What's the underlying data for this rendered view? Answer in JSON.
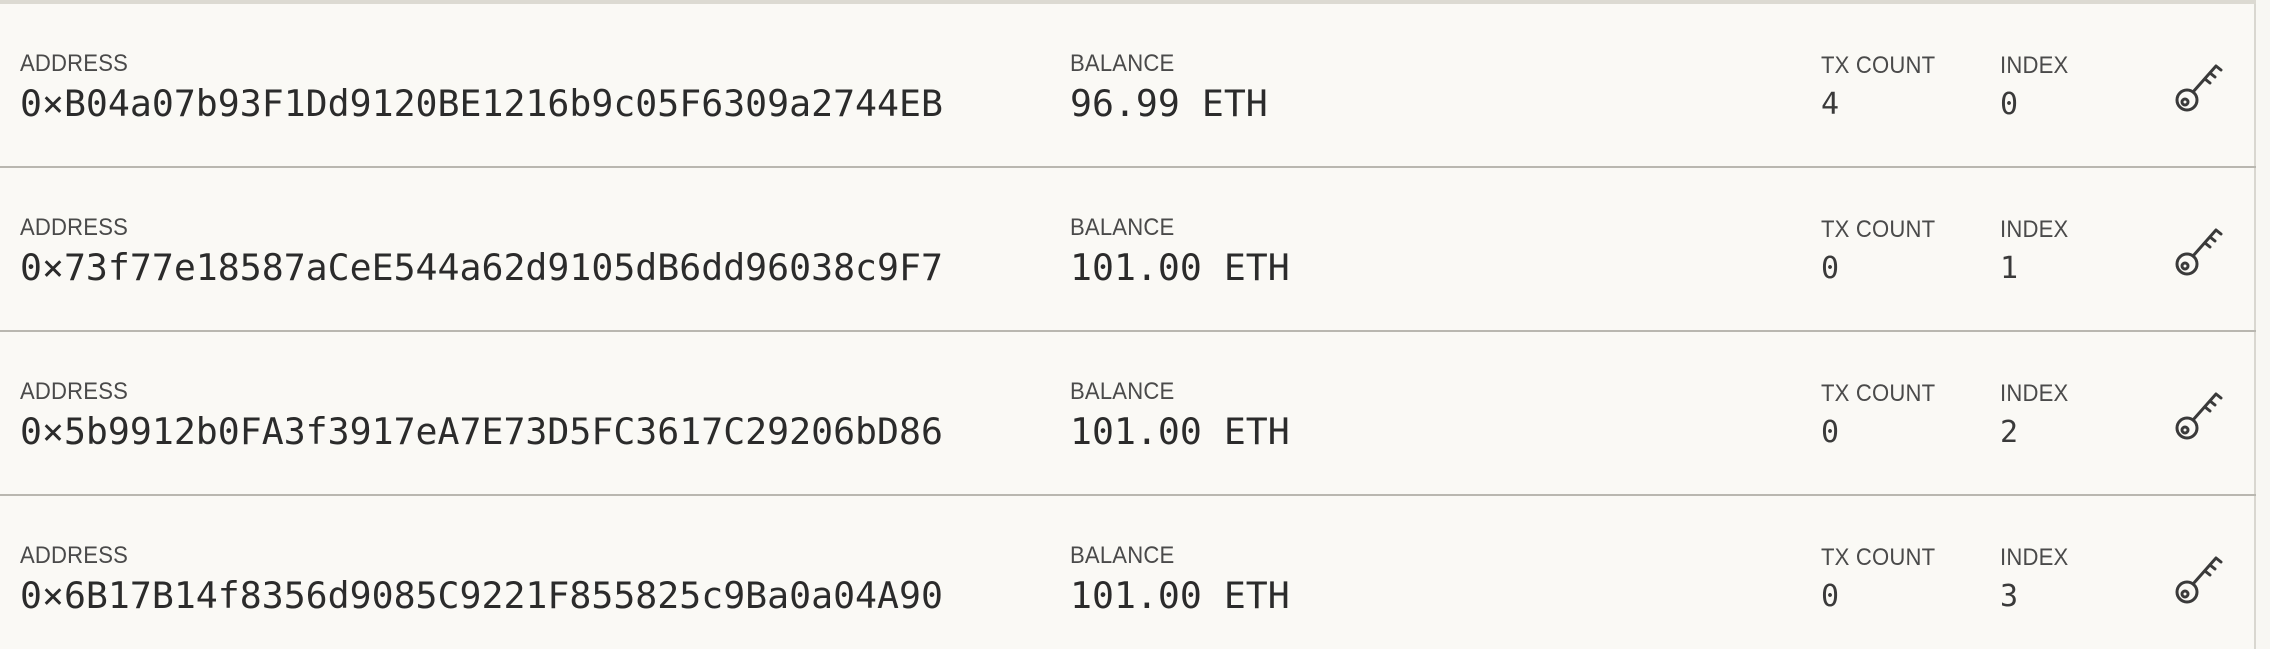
{
  "accounts": [
    {
      "address_label": "ADDRESS",
      "address": "0×B04a07b93F1Dd9120BE1216b9c05F6309a2744EB",
      "balance_label": "BALANCE",
      "balance": "96.99 ETH",
      "tx_count_label": "TX COUNT",
      "tx_count": "4",
      "index_label": "INDEX",
      "index": "0",
      "action_icon": "key-icon"
    },
    {
      "address_label": "ADDRESS",
      "address": "0×73f77e18587aCeE544a62d9105dB6dd96038c9F7",
      "balance_label": "BALANCE",
      "balance": "101.00 ETH",
      "tx_count_label": "TX COUNT",
      "tx_count": "0",
      "index_label": "INDEX",
      "index": "1",
      "action_icon": "key-icon"
    },
    {
      "address_label": "ADDRESS",
      "address": "0×5b9912b0FA3f3917eA7E73D5FC3617C29206bD86",
      "balance_label": "BALANCE",
      "balance": "101.00 ETH",
      "tx_count_label": "TX COUNT",
      "tx_count": "0",
      "index_label": "INDEX",
      "index": "2",
      "action_icon": "key-icon"
    },
    {
      "address_label": "ADDRESS",
      "address": "0×6B17B14f8356d9085C9221F855825c9Ba0a04A90",
      "balance_label": "BALANCE",
      "balance": "101.00 ETH",
      "tx_count_label": "TX COUNT",
      "tx_count": "0",
      "index_label": "INDEX",
      "index": "3",
      "action_icon": "key-icon"
    }
  ],
  "colors": {
    "background": "#faf9f5",
    "row_divider": "#b9b7b0",
    "text": "#2b2b2b",
    "label": "#4a4a4a"
  }
}
